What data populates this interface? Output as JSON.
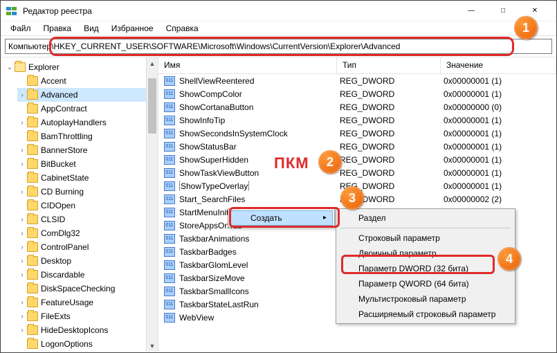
{
  "window": {
    "title": "Редактор реестра",
    "min": "—",
    "max": "□",
    "close": "✕"
  },
  "menu": {
    "file": "Файл",
    "edit": "Правка",
    "view": "Вид",
    "favorites": "Избранное",
    "help": "Справка"
  },
  "address": "Компьютер\\HKEY_CURRENT_USER\\SOFTWARE\\Microsoft\\Windows\\CurrentVersion\\Explorer\\Advanced",
  "columns": {
    "name": "Имя",
    "type": "Тип",
    "value": "Значение"
  },
  "tree": {
    "root": "Explorer",
    "items": [
      {
        "label": "Accent",
        "exp": ""
      },
      {
        "label": "Advanced",
        "exp": ">",
        "sel": true
      },
      {
        "label": "AppContract",
        "exp": ""
      },
      {
        "label": "AutoplayHandlers",
        "exp": ">"
      },
      {
        "label": "BamThrottling",
        "exp": ""
      },
      {
        "label": "BannerStore",
        "exp": ">"
      },
      {
        "label": "BitBucket",
        "exp": ">"
      },
      {
        "label": "CabinetState",
        "exp": ""
      },
      {
        "label": "CD Burning",
        "exp": ">"
      },
      {
        "label": "CIDOpen",
        "exp": ""
      },
      {
        "label": "CLSID",
        "exp": ">"
      },
      {
        "label": "ComDlg32",
        "exp": ">"
      },
      {
        "label": "ControlPanel",
        "exp": ">"
      },
      {
        "label": "Desktop",
        "exp": ">"
      },
      {
        "label": "Discardable",
        "exp": ">"
      },
      {
        "label": "DiskSpaceChecking",
        "exp": ""
      },
      {
        "label": "FeatureUsage",
        "exp": ">"
      },
      {
        "label": "FileExts",
        "exp": ">"
      },
      {
        "label": "HideDesktopIcons",
        "exp": ">"
      },
      {
        "label": "LogonOptions",
        "exp": ""
      }
    ]
  },
  "rows": [
    {
      "name": "ShellViewReentered",
      "type": "REG_DWORD",
      "value": "0x00000001 (1)"
    },
    {
      "name": "ShowCompColor",
      "type": "REG_DWORD",
      "value": "0x00000001 (1)"
    },
    {
      "name": "ShowCortanaButton",
      "type": "REG_DWORD",
      "value": "0x00000000 (0)"
    },
    {
      "name": "ShowInfoTip",
      "type": "REG_DWORD",
      "value": "0x00000001 (1)"
    },
    {
      "name": "ShowSecondsInSystemClock",
      "type": "REG_DWORD",
      "value": "0x00000001 (1)"
    },
    {
      "name": "ShowStatusBar",
      "type": "REG_DWORD",
      "value": "0x00000001 (1)"
    },
    {
      "name": "ShowSuperHidden",
      "type": "REG_DWORD",
      "value": "0x00000001 (1)"
    },
    {
      "name": "ShowTaskViewButton",
      "type": "REG_DWORD",
      "value": "0x00000001 (1)"
    },
    {
      "name": "ShowTypeOverlay",
      "type": "REG_DWORD",
      "value": "0x00000001 (1)",
      "focus": true
    },
    {
      "name": "Start_SearchFiles",
      "type": "REG_DWORD",
      "value": "0x00000002 (2)"
    },
    {
      "name": "StartMenuInit",
      "type": "",
      "value": ""
    },
    {
      "name": "StoreAppsOnTas",
      "type": "",
      "value": ""
    },
    {
      "name": "TaskbarAnimations",
      "type": "",
      "value": ""
    },
    {
      "name": "TaskbarBadges",
      "type": "",
      "value": ""
    },
    {
      "name": "TaskbarGlomLevel",
      "type": "",
      "value": ""
    },
    {
      "name": "TaskbarSizeMove",
      "type": "",
      "value": ""
    },
    {
      "name": "TaskbarSmallIcons",
      "type": "",
      "value": ""
    },
    {
      "name": "TaskbarStateLastRun",
      "type": "",
      "value": ""
    },
    {
      "name": "WebView",
      "type": "",
      "value": ""
    }
  ],
  "ctx1": {
    "create": "Создать"
  },
  "ctx2": {
    "key": "Раздел",
    "string": "Строковый параметр",
    "binary": "Двоичный параметр",
    "dword": "Параметр DWORD (32 бита)",
    "qword": "Параметр QWORD (64 бита)",
    "multi": "Мультистроковый параметр",
    "expand": "Расширяемый строковый параметр"
  },
  "annotations": {
    "pkm": "ПКМ",
    "m1": "1",
    "m2": "2",
    "m3": "3",
    "m4": "4"
  }
}
